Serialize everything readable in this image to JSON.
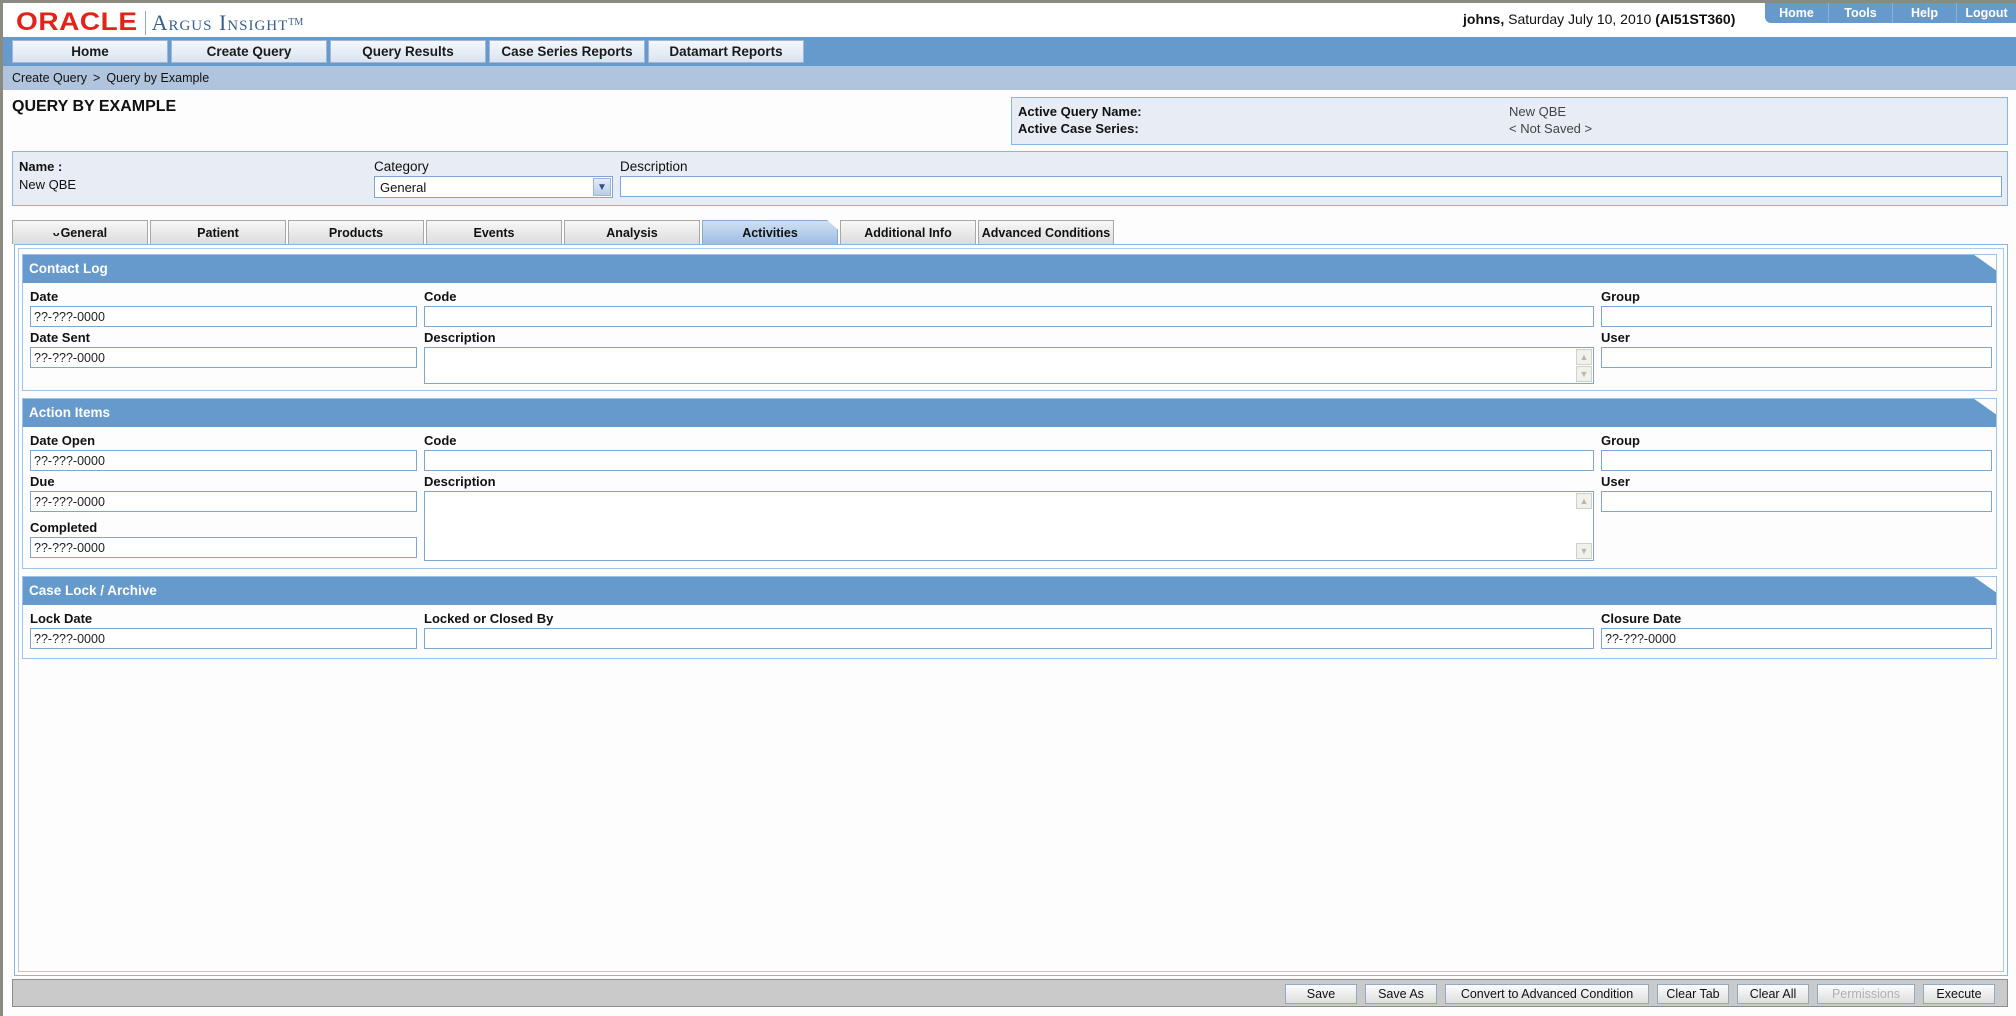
{
  "header": {
    "logo_brand": "ORACLE",
    "logo_product": "Argus Insight",
    "logo_tm": "TM",
    "user": "johns,",
    "date": "Saturday July 10, 2010",
    "server": "(AI51ST360)",
    "util_nav": [
      "Home",
      "Tools",
      "Help",
      "Logout"
    ]
  },
  "main_nav": [
    "Home",
    "Create Query",
    "Query Results",
    "Case Series Reports",
    "Datamart Reports"
  ],
  "breadcrumb": {
    "items": [
      "Create Query",
      "Query by Example"
    ],
    "separator": ">"
  },
  "page_title": "QUERY BY EXAMPLE",
  "active_panel": {
    "query_name_label": "Active Query Name:",
    "query_name_value": "New QBE",
    "case_series_label": "Active Case Series:",
    "case_series_value": "< Not Saved >"
  },
  "name_panel": {
    "name_label": "Name :",
    "name_value": "New QBE",
    "category_label": "Category",
    "category_value": "General",
    "description_label": "Description",
    "description_value": ""
  },
  "tabs": [
    {
      "label": "General",
      "icon": "funnel-icon",
      "active": false
    },
    {
      "label": "Patient",
      "active": false
    },
    {
      "label": "Products",
      "active": false
    },
    {
      "label": "Events",
      "active": false
    },
    {
      "label": "Analysis",
      "active": false
    },
    {
      "label": "Activities",
      "active": true
    },
    {
      "label": "Additional Info",
      "active": false
    },
    {
      "label": "Advanced Conditions",
      "active": false
    }
  ],
  "sections": {
    "contact_log": {
      "title": "Contact Log",
      "date_label": "Date",
      "date_value": "??-???-0000",
      "code_label": "Code",
      "code_value": "",
      "group_label": "Group",
      "group_value": "",
      "date_sent_label": "Date Sent",
      "date_sent_value": "??-???-0000",
      "description_label": "Description",
      "description_value": "",
      "user_label": "User",
      "user_value": ""
    },
    "action_items": {
      "title": "Action Items",
      "date_open_label": "Date Open",
      "date_open_value": "??-???-0000",
      "code_label": "Code",
      "code_value": "",
      "group_label": "Group",
      "group_value": "",
      "due_label": "Due",
      "due_value": "??-???-0000",
      "description_label": "Description",
      "description_value": "",
      "user_label": "User",
      "user_value": "",
      "completed_label": "Completed",
      "completed_value": "??-???-0000"
    },
    "case_lock": {
      "title": "Case Lock / Archive",
      "lock_date_label": "Lock Date",
      "lock_date_value": "??-???-0000",
      "locked_by_label": "Locked or Closed By",
      "locked_by_value": "",
      "closure_date_label": "Closure Date",
      "closure_date_value": "??-???-0000"
    }
  },
  "bottom_buttons": [
    {
      "label": "Save",
      "enabled": true
    },
    {
      "label": "Save As",
      "enabled": true
    },
    {
      "label": "Convert to Advanced Condition",
      "enabled": true
    },
    {
      "label": "Clear Tab",
      "enabled": true
    },
    {
      "label": "Clear All",
      "enabled": true
    },
    {
      "label": "Permissions",
      "enabled": false
    },
    {
      "label": "Execute",
      "enabled": true
    }
  ],
  "colors": {
    "nav_blue": "#6699cc",
    "breadcrumb_bg": "#b0c4de",
    "panel_bg": "#e8ecf4",
    "oracle_red": "#e2231a",
    "input_border": "#7fa6d3"
  }
}
